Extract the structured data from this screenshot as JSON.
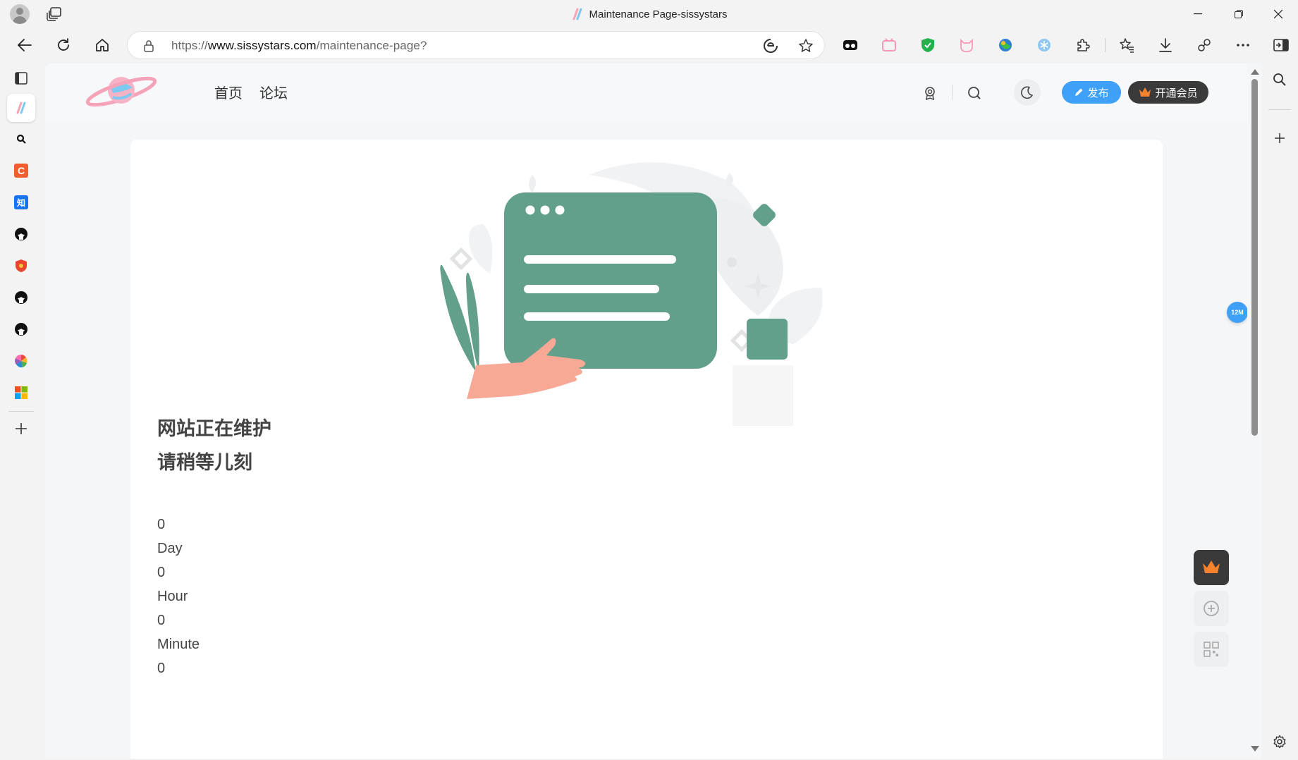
{
  "window": {
    "title": "Maintenance Page-sissystars",
    "controls": [
      "minimize-icon",
      "restore-icon",
      "close-icon"
    ]
  },
  "toolbar": {
    "url_prefix": "https://",
    "url_host": "www.sissystars.com",
    "url_path": "/maintenance-page?",
    "icons": [
      "back-arrow-icon",
      "refresh-icon",
      "home-icon",
      "site-info-icon",
      "read-aloud-icon",
      "favorite-star-icon",
      "extensions-icon",
      "favorites-icon",
      "downloads-icon",
      "copilot-icon",
      "more-icon",
      "sidebar-toggle-icon"
    ]
  },
  "left_sidebar": {
    "items": [
      "vertical-tabs-icon",
      "sissystars-tab",
      "search-tab",
      "csdn-tab",
      "zhihu-tab",
      "github-tab",
      "shield-tab",
      "github-tab",
      "github-tab",
      "pinwheel-tab",
      "microsoft-tab",
      "add-tab-icon"
    ]
  },
  "site": {
    "brand_color": "#3ea0f7",
    "nav": [
      "首页",
      "论坛"
    ],
    "publish_label": "发布",
    "vip_label": "开通会员",
    "float_badge": "12M"
  },
  "maintenance": {
    "line1": "网站正在维护",
    "line2": "请稍等儿刻",
    "countdown": [
      {
        "value": "0",
        "unit": "Day"
      },
      {
        "value": "0",
        "unit": "Hour"
      },
      {
        "value": "0",
        "unit": "Minute"
      },
      {
        "value": "0",
        "unit": ""
      }
    ],
    "illustration_color": "#62a08b"
  }
}
